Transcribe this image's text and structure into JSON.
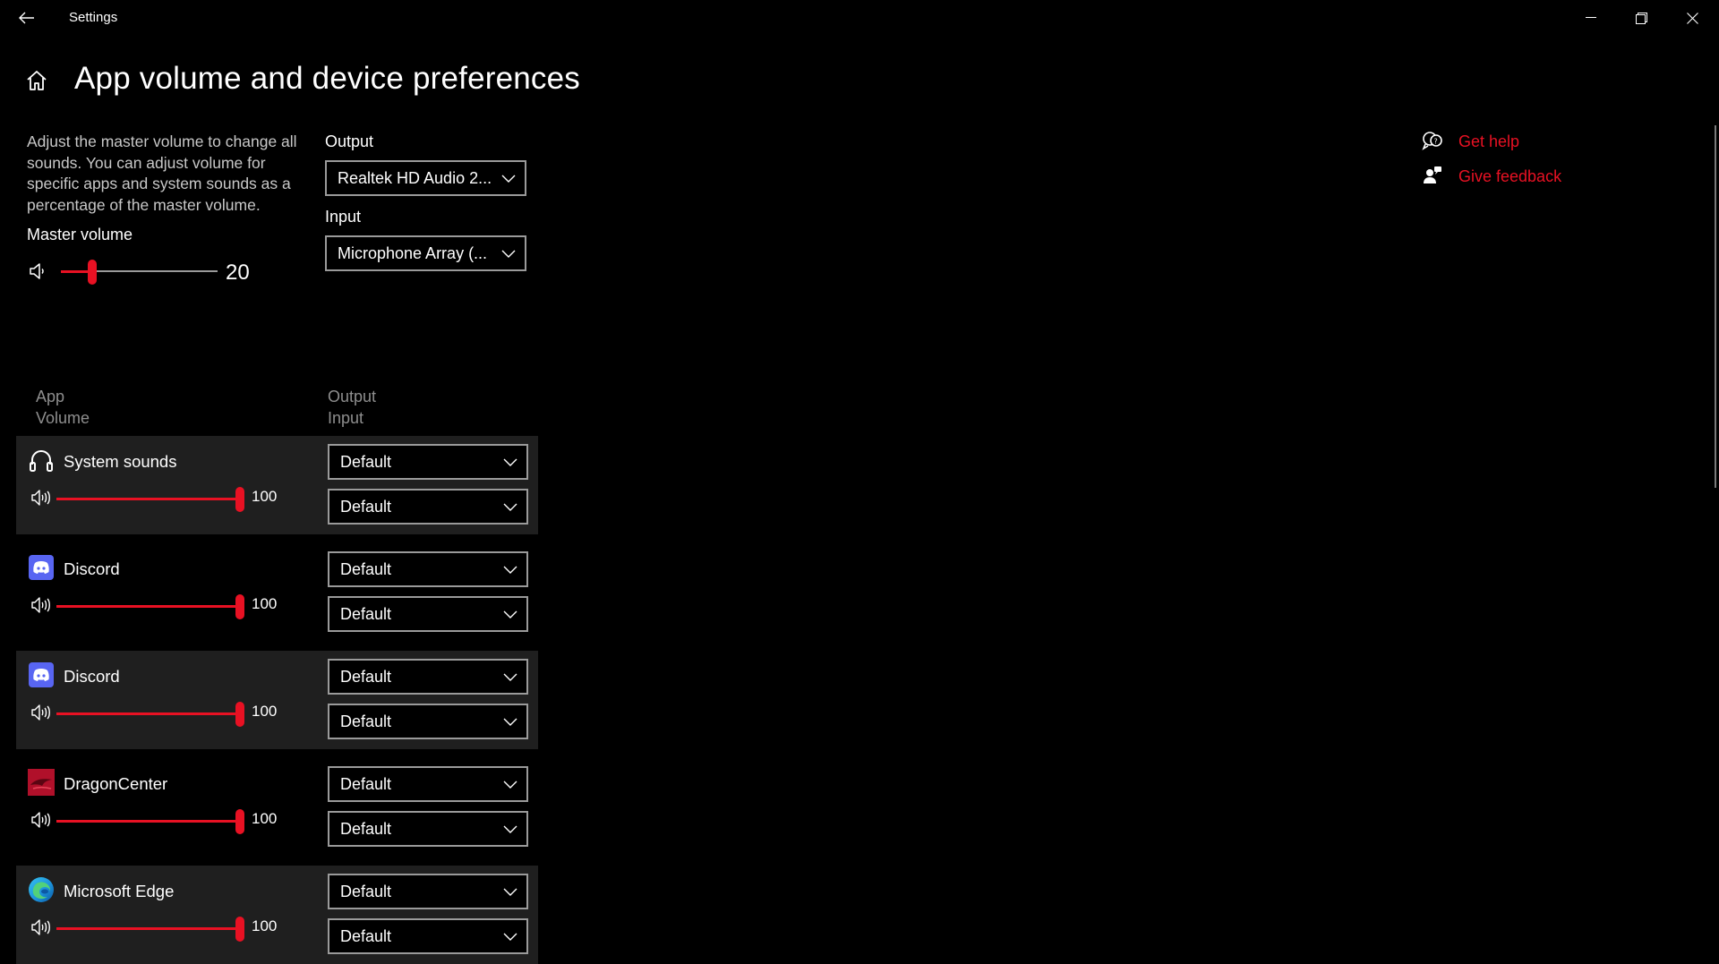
{
  "window": {
    "title": "Settings"
  },
  "page": {
    "title": "App volume and device preferences",
    "description": "Adjust the master volume to change all sounds. You can adjust volume for specific apps and system sounds as a percentage of the master volume.",
    "master_volume_label": "Master volume",
    "master_volume_value": "20",
    "master_volume_level": 0.2
  },
  "output": {
    "label": "Output",
    "selected": "Realtek HD Audio 2..."
  },
  "input": {
    "label": "Input",
    "selected": "Microphone Array (..."
  },
  "columns": {
    "app": "App",
    "volume": "Volume",
    "output": "Output",
    "input": "Input"
  },
  "apps": [
    {
      "name": "System sounds",
      "icon": "headphones-icon",
      "volume": "100",
      "level": 1.0,
      "output": "Default",
      "input": "Default"
    },
    {
      "name": "Discord",
      "icon": "discord-icon",
      "volume": "100",
      "level": 1.0,
      "output": "Default",
      "input": "Default"
    },
    {
      "name": "Discord",
      "icon": "discord-icon",
      "volume": "100",
      "level": 1.0,
      "output": "Default",
      "input": "Default"
    },
    {
      "name": "DragonCenter",
      "icon": "dragoncenter-icon",
      "volume": "100",
      "level": 1.0,
      "output": "Default",
      "input": "Default"
    },
    {
      "name": "Microsoft Edge",
      "icon": "edge-icon",
      "volume": "100",
      "level": 1.0,
      "output": "Default",
      "input": "Default"
    }
  ],
  "links": {
    "get_help": "Get help",
    "give_feedback": "Give feedback"
  },
  "colors": {
    "accent": "#e81123",
    "background": "#000000",
    "row_shade": "#1f1f1f"
  }
}
